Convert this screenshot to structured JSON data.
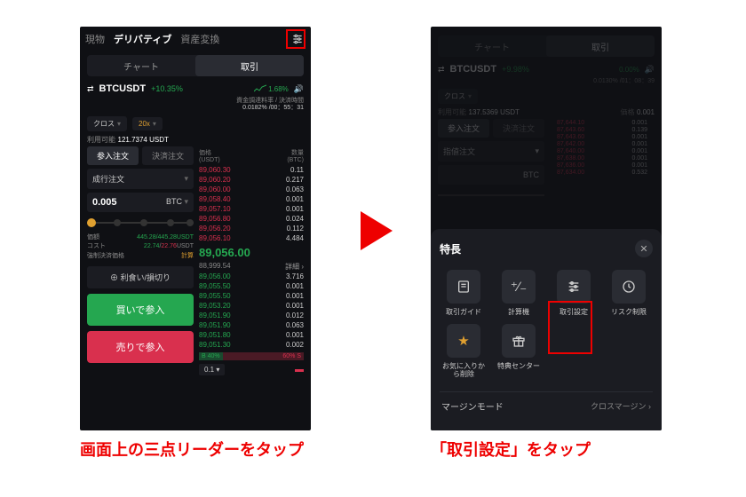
{
  "captions": {
    "left": "画面上の三点リーダーをタップ",
    "right": "「取引設定」をタップ"
  },
  "left": {
    "top_tabs": {
      "spot": "現物",
      "deriv": "デリバティブ",
      "convert": "資産変換"
    },
    "view_seg": {
      "chart": "チャート",
      "trade": "取引"
    },
    "pair": {
      "symbol": "BTCUSDT",
      "change": "+10.35%",
      "mini_pct": "1.68%"
    },
    "funding": {
      "label": "資金調達料率 / 決済時間",
      "value": "0.0182% /00：55：31"
    },
    "margin_mode": "クロス",
    "leverage": "20x",
    "avail_label": "利用可能",
    "avail_value": "121.7374 USDT",
    "ob_head": {
      "price": "価格",
      "price_unit": "(USDT)",
      "qty": "数量",
      "qty_unit": "(BTC)"
    },
    "entry_tabs": {
      "open": "参入注文",
      "close": "決済注文"
    },
    "order_type": "成行注文",
    "qty": "0.005",
    "qty_unit": "BTC",
    "est": {
      "value_label": "価額",
      "value": "445.28/445.28USDT",
      "cost_label": "コスト",
      "cost": "22.74/22.76USDT",
      "liq_label": "強制決済価格",
      "liq": "計算"
    },
    "tpsl": "利食い/損切り",
    "buy": "買いで参入",
    "sell": "売りで参入",
    "asks": [
      {
        "p": "89,060.30",
        "q": "0.11"
      },
      {
        "p": "89,060.20",
        "q": "0.217"
      },
      {
        "p": "89,060.00",
        "q": "0.063"
      },
      {
        "p": "89,058.40",
        "q": "0.001"
      },
      {
        "p": "89,057.10",
        "q": "0.001"
      },
      {
        "p": "89,056.80",
        "q": "0.024"
      },
      {
        "p": "89,056.20",
        "q": "0.112"
      },
      {
        "p": "89,056.10",
        "q": "4.484"
      }
    ],
    "mid": "89,056.00",
    "mid_index": "88,999.54",
    "detail": "詳細",
    "bids": [
      {
        "p": "89,056.00",
        "q": "3.716"
      },
      {
        "p": "89,055.50",
        "q": "0.001"
      },
      {
        "p": "89,055.50",
        "q": "0.001"
      },
      {
        "p": "89,053.20",
        "q": "0.001"
      },
      {
        "p": "89,051.90",
        "q": "0.012"
      },
      {
        "p": "89,051.90",
        "q": "0.063"
      },
      {
        "p": "89,051.80",
        "q": "0.001"
      },
      {
        "p": "89,051.30",
        "q": "0.002"
      }
    ],
    "ratio": {
      "b_label": "B",
      "b": "40%",
      "s": "60%",
      "s_label": "S"
    },
    "step": "0.1"
  },
  "right": {
    "view_seg": {
      "chart": "チャート",
      "trade": "取引"
    },
    "pair": {
      "symbol": "BTCUSDT",
      "change": "+9.98%",
      "mini": "0.00%"
    },
    "funding": "0.0130% /01：08：39",
    "margin_mode": "クロス",
    "avail_label": "利用可能",
    "avail_value": "137.5369 USDT",
    "ph": {
      "a": "価格",
      "b": "0.001"
    },
    "entry_tabs": {
      "open": "参入注文",
      "close": "決済注文"
    },
    "order_type": "指値注文",
    "qty_unit": "BTC",
    "bg_asks": [
      {
        "p": "87,644.10",
        "q": "0.001"
      },
      {
        "p": "87,643.60",
        "q": "0.139"
      },
      {
        "p": "87,643.60",
        "q": "0.001"
      },
      {
        "p": "87,642.00",
        "q": "0.001"
      },
      {
        "p": "87,640.00",
        "q": "0.001"
      },
      {
        "p": "87,638.00",
        "q": "0.001"
      },
      {
        "p": "87,636.00",
        "q": "0.001"
      },
      {
        "p": "87,634.00",
        "q": "0.532"
      }
    ],
    "sheet": {
      "title": "特長",
      "items": [
        {
          "icon": "guide",
          "label": "取引ガイド"
        },
        {
          "icon": "calc",
          "label": "計算機"
        },
        {
          "icon": "settings",
          "label": "取引設定"
        },
        {
          "icon": "risk",
          "label": "リスク制限"
        },
        {
          "icon": "star",
          "label": "お気に入りから削除"
        },
        {
          "icon": "gift",
          "label": "特典センター"
        }
      ],
      "row": {
        "label": "マージンモード",
        "value": "クロスマージン"
      }
    }
  }
}
